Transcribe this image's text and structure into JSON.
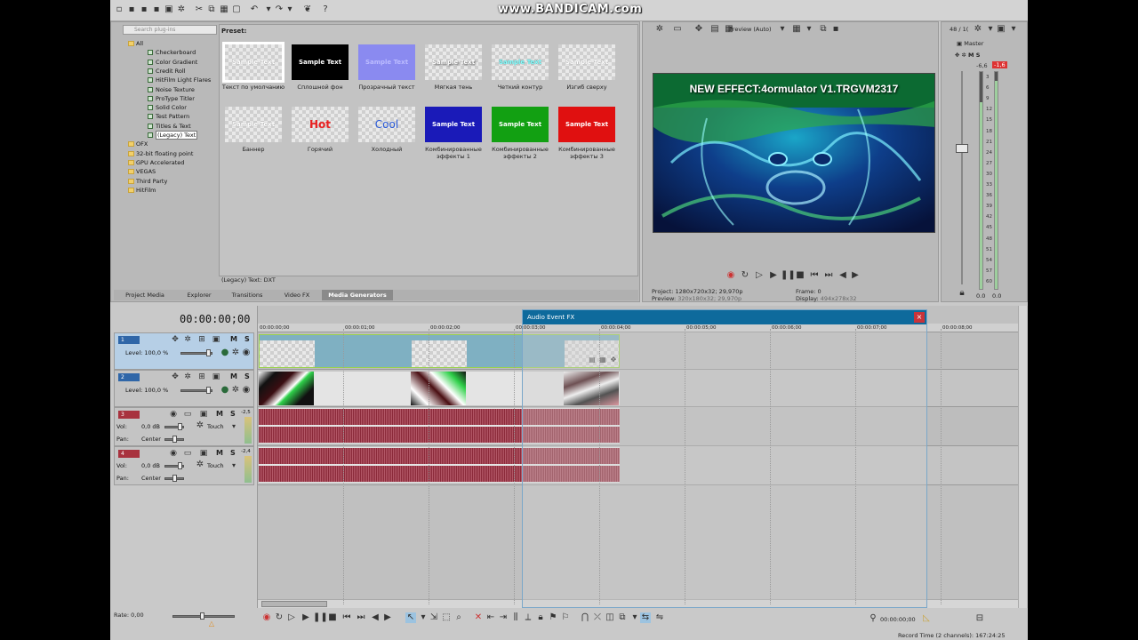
{
  "watermark": "www.BANDICAM.com",
  "explorer": {
    "search_placeholder": "Search plug-ins",
    "tree": [
      "All",
      "Checkerboard",
      "Color Gradient",
      "Credit Roll",
      "HitFilm Light Flares",
      "Noise Texture",
      "ProType Titler",
      "Solid Color",
      "Test Pattern",
      "Titles & Text",
      "(Legacy) Text",
      "OFX",
      "32-bit floating point",
      "GPU Accelerated",
      "VEGAS",
      "Third Party",
      "HitFilm"
    ],
    "preset_heading": "Preset:",
    "status": "(Legacy) Text: DXT",
    "presets": [
      {
        "tile": "Sample Text",
        "label": "Текст по умолчанию"
      },
      {
        "tile": "Sample Text",
        "label": "Сплошной фон"
      },
      {
        "tile": "Sample Text",
        "label": "Прозрачный текст"
      },
      {
        "tile": "Sample Text",
        "label": "Мягкая тень"
      },
      {
        "tile": "Sample Text",
        "label": "Четкий контур"
      },
      {
        "tile": "Sample Text",
        "label": "Изгиб сверху"
      },
      {
        "tile": "Sample Text",
        "label": "Баннер"
      },
      {
        "tile": "Hot",
        "label": "Горячий"
      },
      {
        "tile": "Cool",
        "label": "Холодный"
      },
      {
        "tile": "Sample Text",
        "label": "Комбинированные эффекты 1"
      },
      {
        "tile": "Sample Text",
        "label": "Комбинированные эффекты 2"
      },
      {
        "tile": "Sample Text",
        "label": "Комбинированные эффекты 3"
      }
    ],
    "tabs": [
      "Project Media",
      "Explorer",
      "Transitions",
      "Video FX",
      "Media Generators"
    ]
  },
  "preview": {
    "mode": "Preview (Auto)",
    "title": "NEW EFFECT:4ormulator V1.TRGVM2317",
    "project_label": "Project:",
    "project_value": "1280x720x32; 29,970p",
    "preview_label": "Preview:",
    "preview_value": "320x180x32; 29,970p",
    "frame_label": "Frame:",
    "frame_value": "0",
    "display_label": "Display:",
    "display_value": "494x278x32"
  },
  "mixer": {
    "counter": "48 / 1(",
    "master": "Master",
    "peak_left": "-6,6",
    "peak_right": "-1,6",
    "scale": [
      "3",
      "6",
      "9",
      "12",
      "15",
      "18",
      "21",
      "24",
      "27",
      "30",
      "33",
      "36",
      "39",
      "42",
      "45",
      "48",
      "51",
      "54",
      "57",
      "60"
    ],
    "out_left": "0.0",
    "out_right": "0.0"
  },
  "timeline": {
    "timecode": "00:00:00;00",
    "ruler": [
      "00:00:00;00",
      "00:00:01;00",
      "00:00:02;00",
      "00:00:03;00",
      "00:00:04;00",
      "00:00:05;00",
      "00:00:06;00",
      "00:00:07;00",
      "00:00:08;00"
    ],
    "tracks": [
      {
        "num": "1",
        "level": "Level: 100,0 %",
        "m": "M",
        "s": "S"
      },
      {
        "num": "2",
        "level": "Level: 100,0 %",
        "m": "M",
        "s": "S"
      },
      {
        "num": "3",
        "vol": "Vol:",
        "vol_value": "0,0 dB",
        "pan": "Pan:",
        "pan_value": "Center",
        "touch": "Touch",
        "m": "M",
        "s": "S",
        "meter": "-2,5"
      },
      {
        "num": "4",
        "vol": "Vol:",
        "vol_value": "0,0 dB",
        "pan": "Pan:",
        "pan_value": "Center",
        "touch": "Touch",
        "m": "M",
        "s": "S",
        "meter": "-2,4"
      }
    ],
    "rate": "Rate: 0,00",
    "bottom_timecode": "00:00:00;00",
    "record_time": "Record Time (2 channels): 167:24:25"
  },
  "audio_fx_window": {
    "title": "Audio Event FX",
    "close": "×"
  },
  "colors": {
    "accent": "#0e6a9c",
    "video_track": "#7fb0c2",
    "audio_wave": "#8b2a3a",
    "clip_border": "#9ad24a"
  }
}
